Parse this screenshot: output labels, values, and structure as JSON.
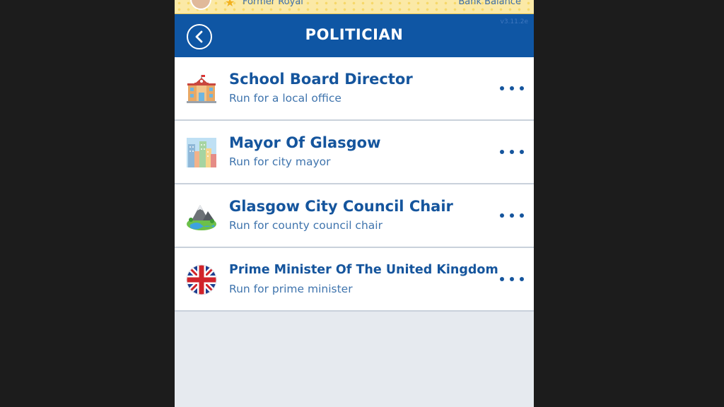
{
  "status": {
    "left_label": "Former Royal",
    "right_label": "Bank Balance"
  },
  "header": {
    "title": "POLITICIAN",
    "version": "v3.11.2e",
    "back_icon": "chevron-left-icon"
  },
  "offices": [
    {
      "title": "School Board Director",
      "subtitle": "Run for a local office",
      "icon": "school-icon"
    },
    {
      "title": "Mayor Of Glasgow",
      "subtitle": "Run for city mayor",
      "icon": "city-skyline-icon"
    },
    {
      "title": "Glasgow City Council Chair",
      "subtitle": "Run for county council chair",
      "icon": "landscape-icon"
    },
    {
      "title": "Prime Minister Of The United Kingdom",
      "subtitle": "Run for prime minister",
      "icon": "uk-flag-icon"
    }
  ],
  "colors": {
    "header_bg": "#0f56a4",
    "title_text": "#15559d",
    "subtitle_text": "#3f74ad",
    "list_bg": "#e6eaef"
  }
}
